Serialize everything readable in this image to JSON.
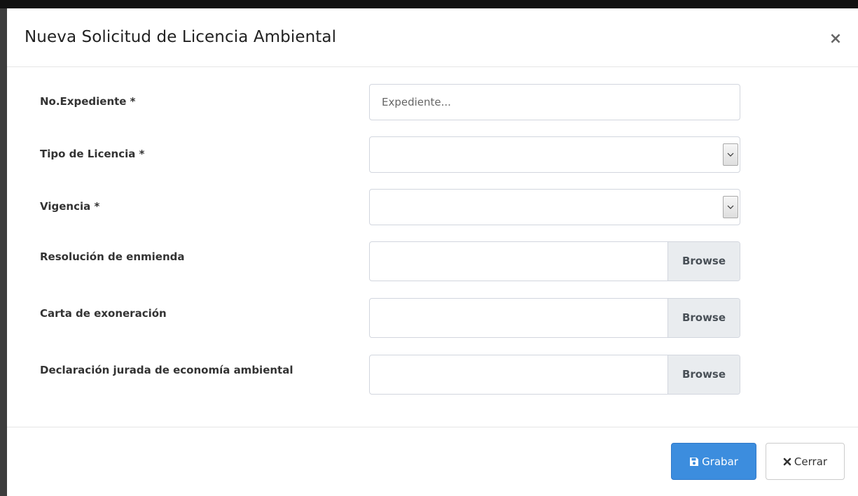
{
  "modal": {
    "title": "Nueva Solicitud de Licencia Ambiental",
    "close_label": "×"
  },
  "form": {
    "expediente": {
      "label": "No.Expediente *",
      "placeholder": "Expediente...",
      "value": ""
    },
    "tipo_licencia": {
      "label": "Tipo de Licencia *",
      "selected": ""
    },
    "vigencia": {
      "label": "Vigencia *",
      "selected": ""
    },
    "resolucion_enmienda": {
      "label": "Resolución de enmienda",
      "browse_label": "Browse"
    },
    "carta_exoneracion": {
      "label": "Carta de exoneración",
      "browse_label": "Browse"
    },
    "declaracion_jurada": {
      "label": "Declaración jurada de economía ambiental",
      "browse_label": "Browse"
    }
  },
  "footer": {
    "save_label": "Grabar",
    "save_icon": "floppy-disk-icon",
    "close_label": "Cerrar",
    "close_icon": "x-icon"
  },
  "colors": {
    "primary": "#3c8dde",
    "browse_bg": "#e9ecef"
  }
}
